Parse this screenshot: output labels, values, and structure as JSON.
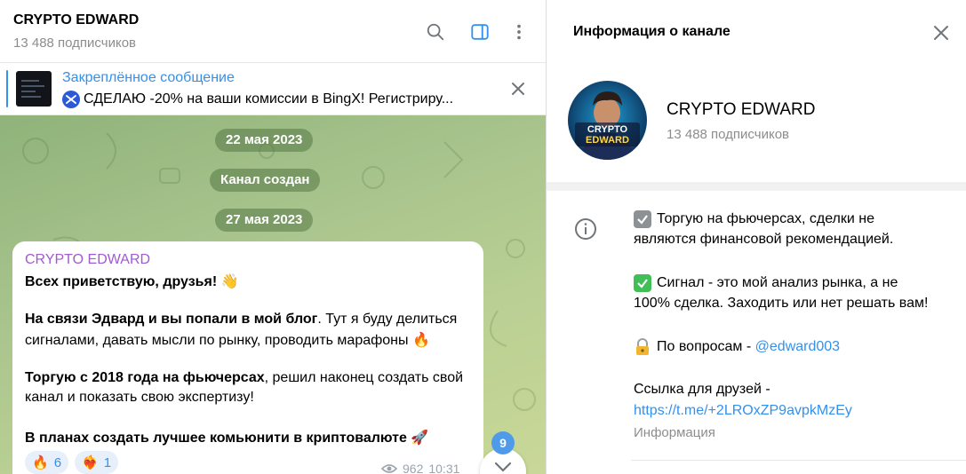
{
  "header": {
    "title": "CRYPTO EDWARD",
    "subscribers": "13 488 подписчиков",
    "icons": [
      "search-icon",
      "sidebar-toggle-icon",
      "more-vertical-icon"
    ]
  },
  "pinned": {
    "title": "Закреплённое сообщение",
    "text": "СДЕЛАЮ -20% на ваши комиссии в BingX!   Регистриру..."
  },
  "dates": {
    "first": "22 мая 2023",
    "service": "Канал создан",
    "second": "27 мая 2023"
  },
  "message": {
    "author": "CRYPTO EDWARD",
    "greeting": "Всех приветствую, друзья! 👋",
    "p2_bold": "На связи Эдвард и вы попали в мой блог",
    "p2_rest": ". Тут я буду делиться",
    "p2_line2": "сигналами, давать мысли по рынку, проводить марафоны 🔥",
    "p3_bold": "Торгую с 2018 года на фьючерсах",
    "p3_rest": ", решил наконец создать свой",
    "p3_line2": "канал и показать свою экспертизу!",
    "p4_bold": "В планах создать лучшее комьюнити в криптовалюте 🚀",
    "reactions": [
      {
        "emoji": "🔥",
        "count": "6"
      },
      {
        "emoji": "❤️‍🔥",
        "count": "1"
      }
    ],
    "views": "962",
    "time": "10:31"
  },
  "unread_count": "9",
  "info": {
    "title": "Информация о канале",
    "channel_name": "CRYPTO EDWARD",
    "subscribers": "13 488 подписчиков",
    "avatar_text_1": "CRYPTO",
    "avatar_text_2": "EDWARD",
    "desc_line1": "Торгую на фьючерсах, сделки не",
    "desc_line2": "являются финансовой рекомендацией.",
    "desc_line3": "Сигнал - это мой анализ рынка, а не",
    "desc_line4": "100% сделка. Заходить или нет решать вам!",
    "desc_line5_prefix": "По вопросам - ",
    "desc_line5_link": "@edward003",
    "desc_line6": "Ссылка для друзей -",
    "desc_link": "https://t.me/+2LROxZP9avpkMzEy",
    "label": "Информация"
  },
  "colors": {
    "accent": "#3390ec",
    "author": "#a05ad3",
    "chat_bg": "#a7c38c"
  }
}
